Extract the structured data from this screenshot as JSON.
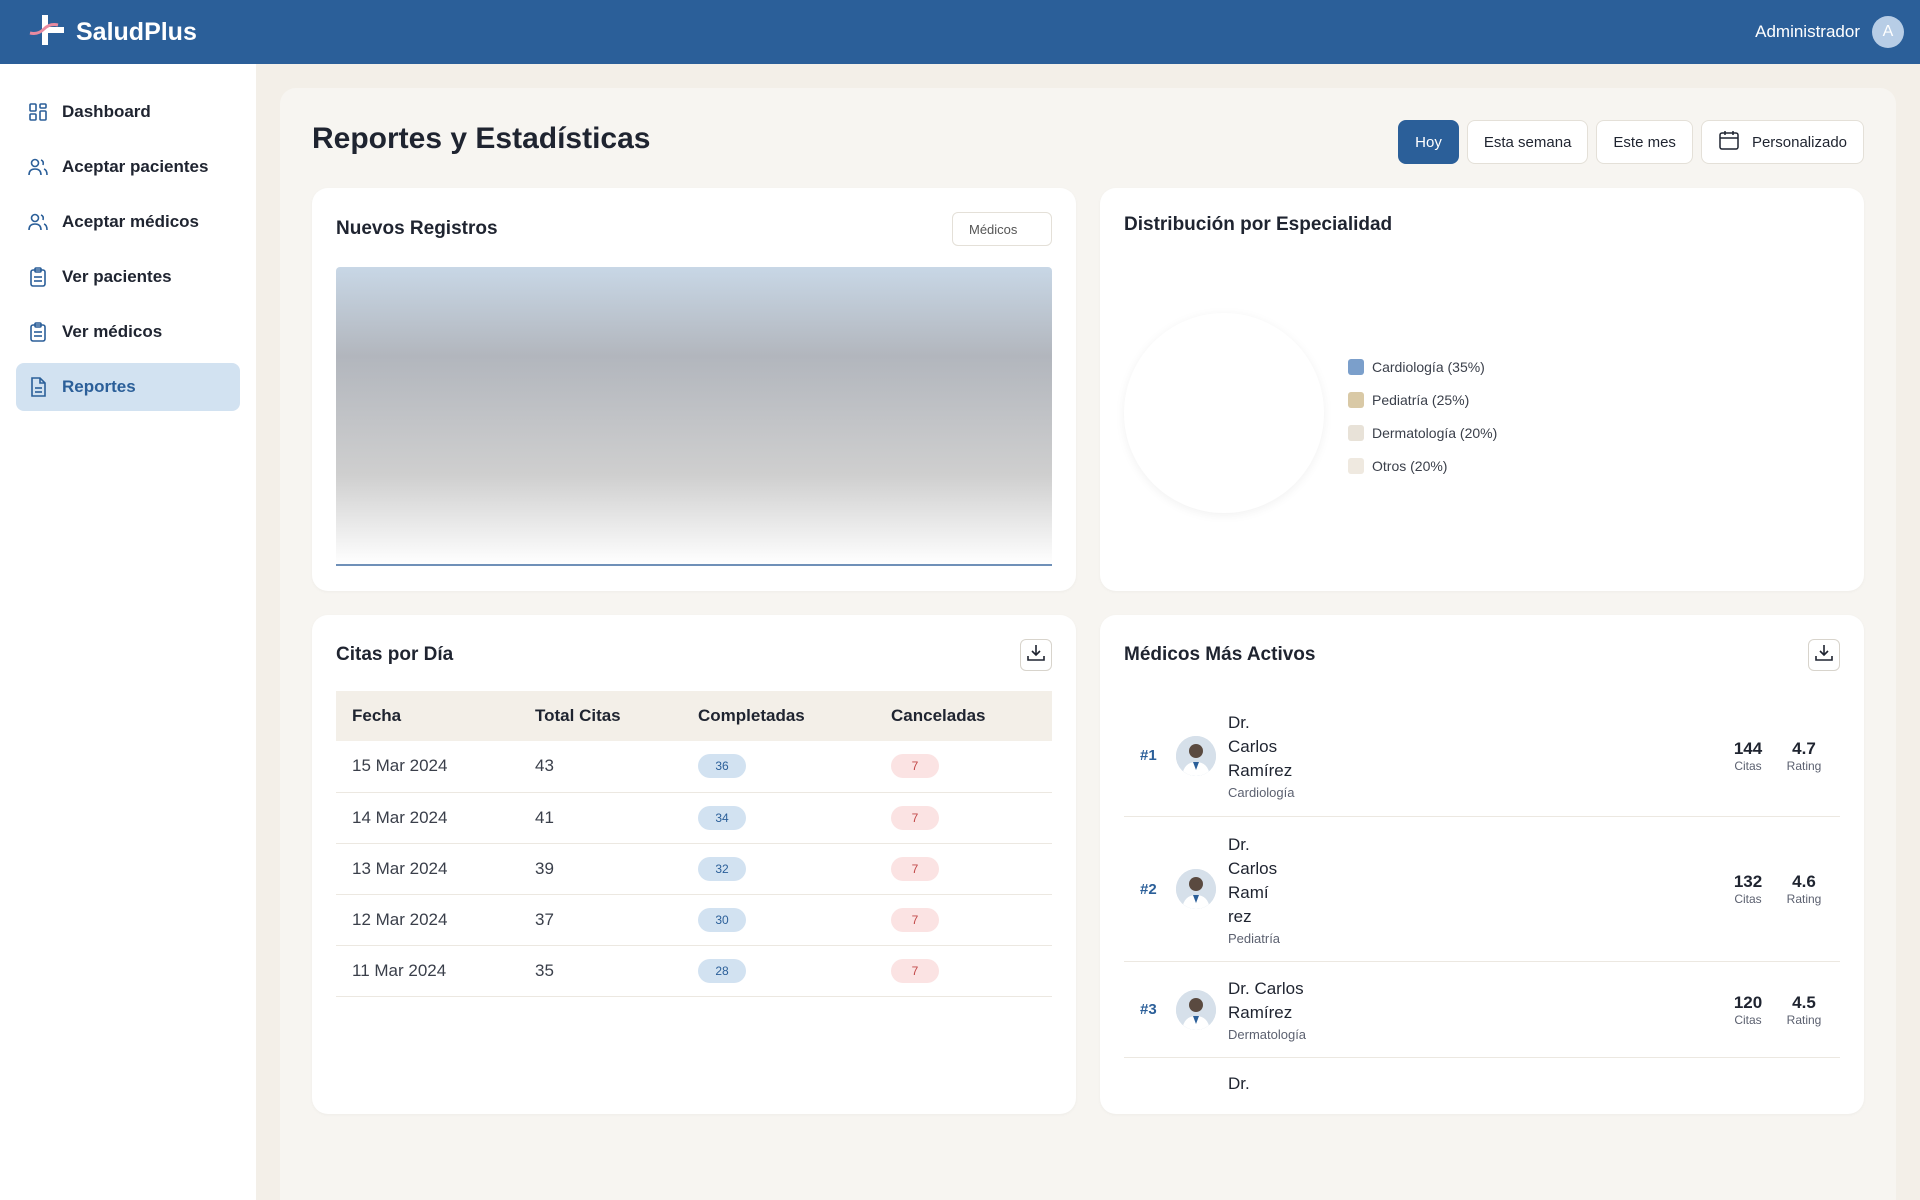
{
  "header": {
    "brand": "SaludPlus",
    "user_name": "Administrador",
    "avatar_initial": "A"
  },
  "sidebar": {
    "items": [
      {
        "label": "Dashboard",
        "icon": "grid-icon"
      },
      {
        "label": "Aceptar pacientes",
        "icon": "users-icon"
      },
      {
        "label": "Aceptar médicos",
        "icon": "users-icon"
      },
      {
        "label": "Ver pacientes",
        "icon": "clipboard-icon"
      },
      {
        "label": "Ver médicos",
        "icon": "clipboard-icon"
      },
      {
        "label": "Reportes",
        "icon": "document-icon",
        "active": true
      }
    ]
  },
  "page": {
    "title": "Reportes y Estadísticas"
  },
  "filters": {
    "today": "Hoy",
    "week": "Esta semana",
    "month": "Este mes",
    "custom": "Personalizado",
    "active": "Hoy"
  },
  "registros": {
    "title": "Nuevos Registros",
    "select_value": "Médicos"
  },
  "especialidad": {
    "title": "Distribución por Especialidad",
    "legend": [
      {
        "label": "Cardiología (35%)",
        "color": "#7b9fcb"
      },
      {
        "label": "Pediatría (25%)",
        "color": "#d9c9a6"
      },
      {
        "label": "Dermatología (20%)",
        "color": "#e8e2d8"
      },
      {
        "label": "Otros (20%)",
        "color": "#efe9e0"
      }
    ]
  },
  "citas": {
    "title": "Citas por Día",
    "columns": [
      "Fecha",
      "Total Citas",
      "Completadas",
      "Canceladas"
    ],
    "rows": [
      [
        "15 Mar 2024",
        "43",
        "36",
        "7"
      ],
      [
        "14 Mar 2024",
        "41",
        "34",
        "7"
      ],
      [
        "13 Mar 2024",
        "39",
        "32",
        "7"
      ],
      [
        "12 Mar 2024",
        "37",
        "30",
        "7"
      ],
      [
        "11 Mar 2024",
        "35",
        "28",
        "7"
      ]
    ]
  },
  "medicos": {
    "title": "Médicos Más Activos",
    "citas_label": "Citas",
    "rating_label": "Rating",
    "rows": [
      {
        "rank": "#1",
        "name_lines": [
          "Dr.",
          "Carlos",
          "Ramírez"
        ],
        "specialty": "Cardiología",
        "citas": "144",
        "rating": "4.7"
      },
      {
        "rank": "#2",
        "name_lines": [
          "Dr.",
          "Carlos",
          "Ramí",
          "rez"
        ],
        "specialty": "Pediatría",
        "citas": "132",
        "rating": "4.6"
      },
      {
        "rank": "#3",
        "name_lines": [
          "Dr. Carlos",
          "Ramírez"
        ],
        "specialty": "Dermatología",
        "citas": "120",
        "rating": "4.5"
      },
      {
        "rank": "",
        "name_lines": [
          "Dr."
        ],
        "specialty": "",
        "citas": "",
        "rating": ""
      }
    ]
  },
  "colors": {
    "primary": "#2b5f99",
    "active_bg": "#d2e2f1",
    "page_bg": "#f3efe8"
  }
}
